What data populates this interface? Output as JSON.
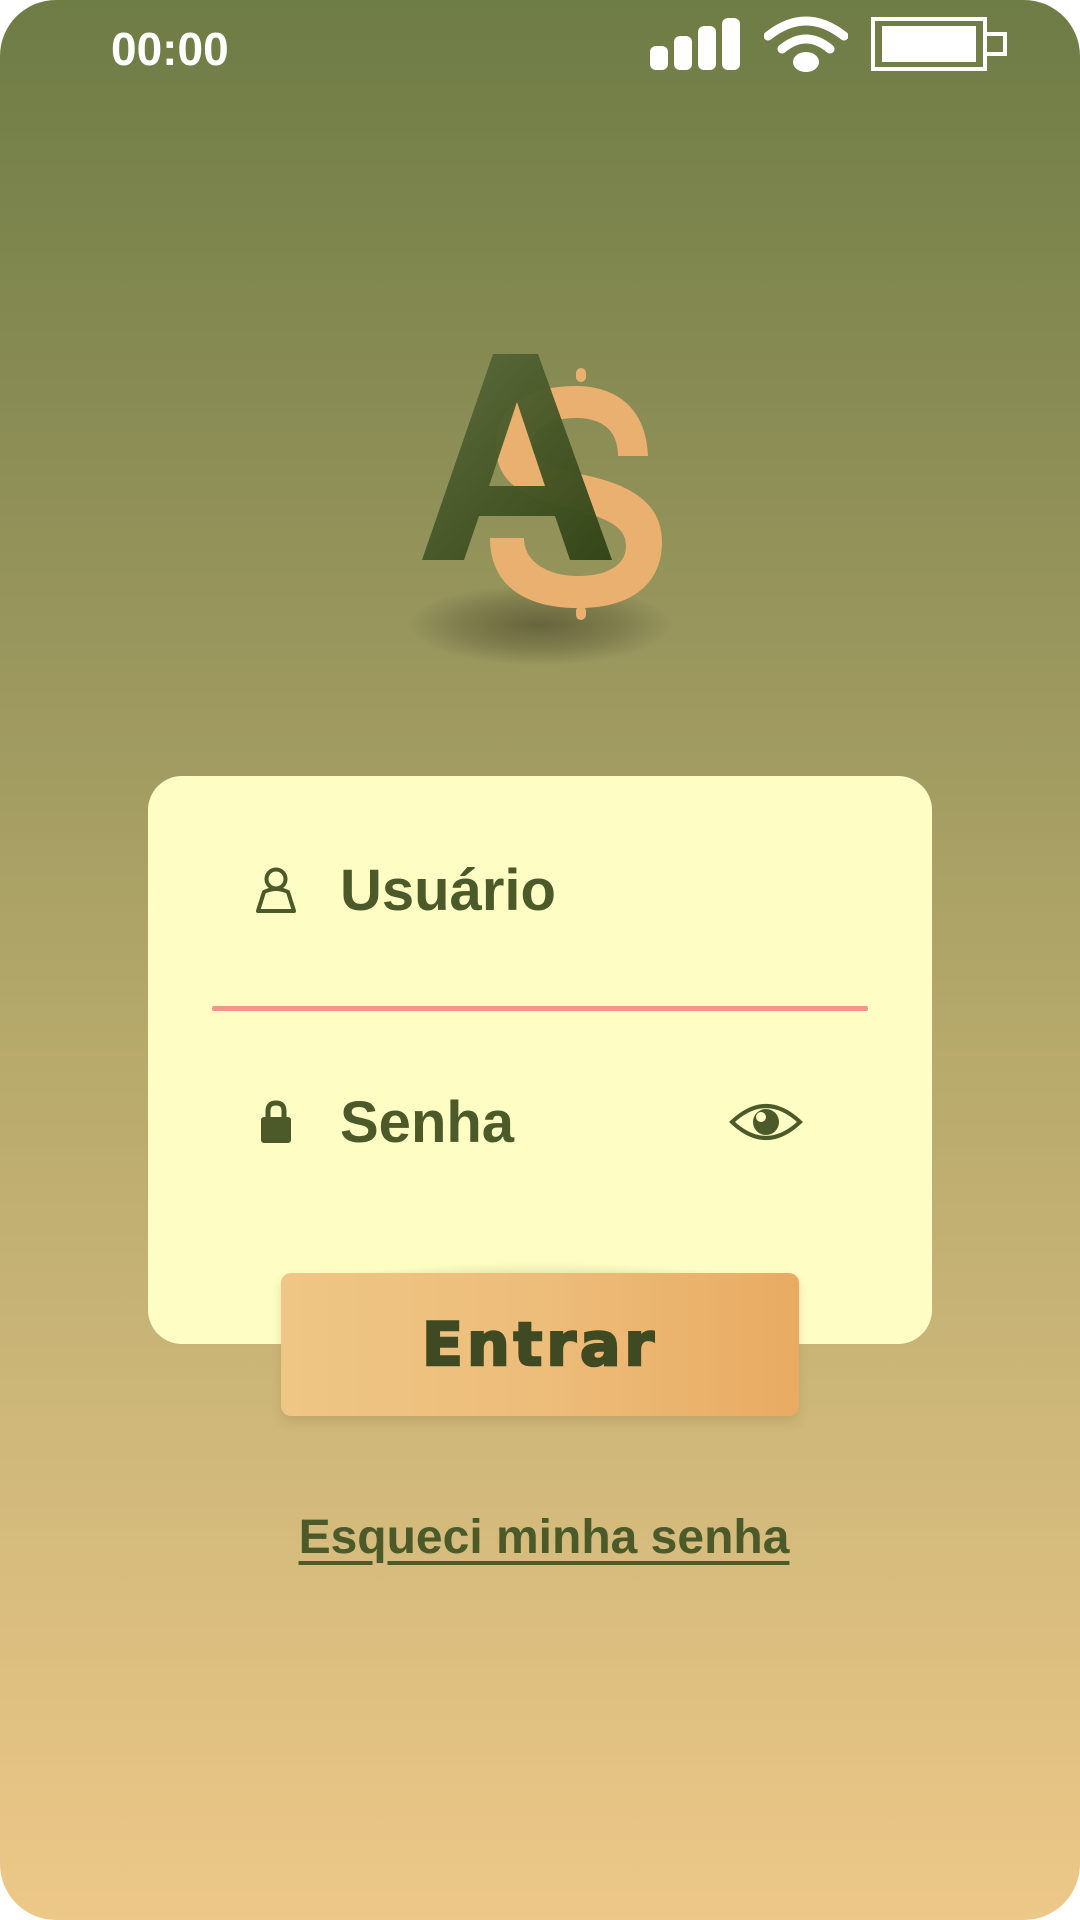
{
  "status_bar": {
    "time": "00:00"
  },
  "logo": {
    "letters": "AS",
    "colors": {
      "a": "#465a2a",
      "s": "#eab070"
    }
  },
  "login": {
    "username_label": "Usuário",
    "password_label": "Senha",
    "submit_label": "Entrar",
    "forgot_label": "Esqueci minha senha"
  },
  "icons": {
    "user": "user-icon",
    "lock": "lock-icon",
    "eye": "eye-icon",
    "signal": "signal-icon",
    "wifi": "wifi-icon",
    "battery": "battery-icon"
  },
  "colors": {
    "background_top": "#6e7c45",
    "background_bottom": "#edc888",
    "card": "#fdfdc4",
    "text": "#4b5a28",
    "divider": "#f0978d",
    "button_left": "#efc685",
    "button_right": "#e9ab62"
  }
}
